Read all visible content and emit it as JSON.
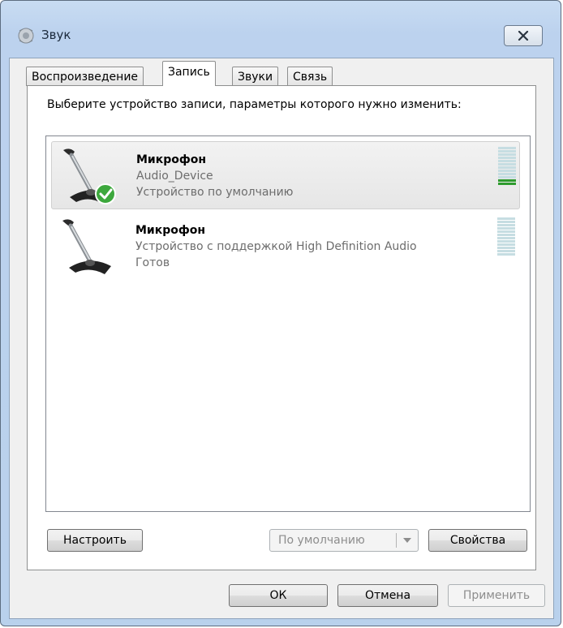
{
  "window": {
    "title": "Звук",
    "icon": "speaker-icon",
    "close_icon": "close-icon"
  },
  "tabs": [
    {
      "label": "Воспроизведение",
      "active": false
    },
    {
      "label": "Запись",
      "active": true
    },
    {
      "label": "Звуки",
      "active": false
    },
    {
      "label": "Связь",
      "active": false
    }
  ],
  "description": "Выберите устройство записи, параметры которого нужно изменить:",
  "devices": [
    {
      "name": "Микрофон",
      "line2": "Audio_Device",
      "line3": "Устройство по умолчанию",
      "selected": true,
      "is_default": true,
      "level_segments_on": 2,
      "level_segments_total": 12
    },
    {
      "name": "Микрофон",
      "line2": "Устройство с поддержкой High Definition Audio",
      "line3": "Готов",
      "selected": false,
      "is_default": false,
      "level_segments_on": 0,
      "level_segments_total": 12
    }
  ],
  "buttons": {
    "configure": "Настроить",
    "set_default": "По умолчанию",
    "properties": "Свойства",
    "ok": "ОК",
    "cancel": "Отмена",
    "apply": "Применить"
  },
  "colors": {
    "accent_green": "#2e9b2e",
    "meter_idle": "#c6dde2",
    "title_bar": "#bcd2ee"
  }
}
